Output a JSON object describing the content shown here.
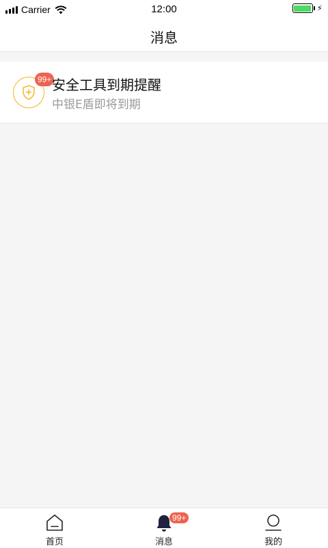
{
  "status_bar": {
    "carrier": "Carrier",
    "time": "12:00",
    "battery_color": "#4cd964"
  },
  "nav": {
    "title": "消息"
  },
  "messages": [
    {
      "title": "安全工具到期提醒",
      "subtitle": "中银E盾即将到期",
      "badge": "99+",
      "icon": "shield-plus-icon",
      "icon_color": "#f5b627"
    }
  ],
  "tab_bar": {
    "tabs": [
      {
        "label": "首页",
        "icon": "home-icon"
      },
      {
        "label": "消息",
        "icon": "bell-icon",
        "badge": "99+"
      },
      {
        "label": "我的",
        "icon": "user-icon"
      }
    ]
  },
  "colors": {
    "badge": "#ee6350",
    "background": "#f5f5f5"
  }
}
